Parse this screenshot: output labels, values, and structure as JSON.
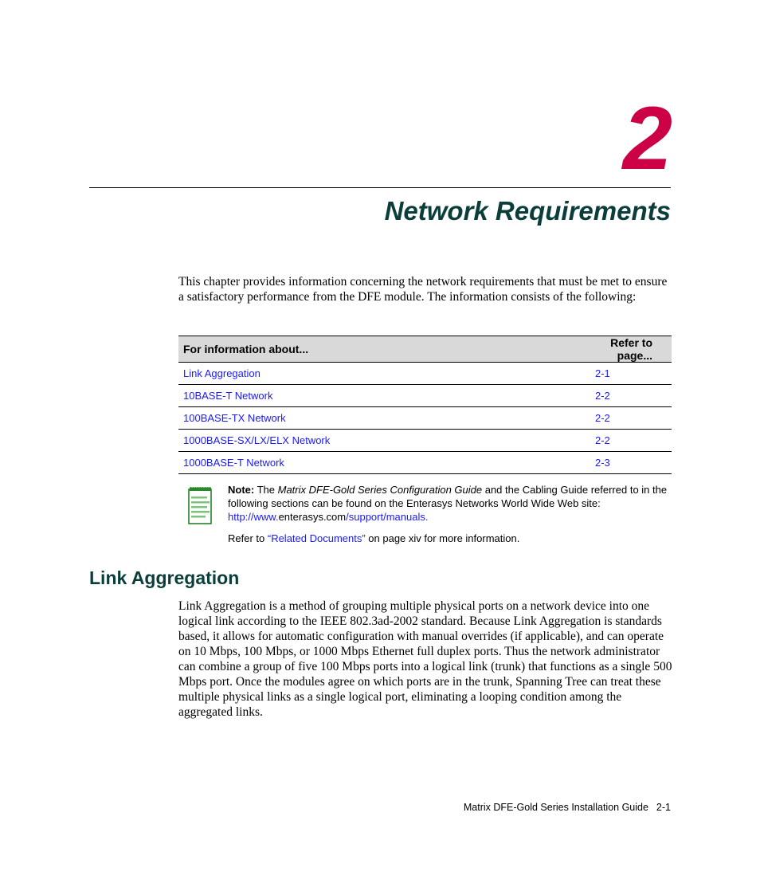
{
  "chapter": {
    "number": "2",
    "title": "Network Requirements",
    "number_color": "#cc0044",
    "title_color": "#0b3d3a"
  },
  "intro": "This chapter provides information concerning the network requirements that must be met to ensure a satisfactory performance from the DFE  module. The information consists of the following:",
  "toc": {
    "headers": [
      "For information about...",
      "Refer to page..."
    ],
    "rows": [
      {
        "topic": "Link Aggregation",
        "page": "2-1"
      },
      {
        "topic": "10BASE-T Network",
        "page": "2-2"
      },
      {
        "topic": "100BASE-TX Network",
        "page": "2-2"
      },
      {
        "topic": "1000BASE-SX/LX/ELX Network",
        "page": "2-2"
      },
      {
        "topic": "1000BASE-T Network",
        "page": "2-3"
      }
    ]
  },
  "note": {
    "icon": "notepad-icon",
    "label": "Note:",
    "text_before": " The ",
    "guide_title": "Matrix DFE-Gold Series Configuration Guide",
    "text_after": " and the Cabling Guide referred to in the following sections can be found on the Enterasys Networks World Wide Web site: ",
    "url_part1": "http://www.",
    "url_part2": "enterasys.com",
    "url_part3": "/support/manuals.",
    "refer_prefix": "Refer to  ",
    "refer_link": "“Related Documents”",
    "refer_suffix": " on page xiv for more information."
  },
  "section": {
    "heading": "Link Aggregation",
    "body": "Link Aggregation is a method of grouping multiple physical ports on a network device into one logical link according to the IEEE 802.3ad-2002 standard. Because Link Aggregation is standards based, it allows for automatic configuration with manual overrides (if applicable), and can operate on 10 Mbps, 100 Mbps, or 1000 Mbps Ethernet full duplex ports. Thus the network administrator can combine a group of five 100 Mbps ports into a logical link (trunk) that functions as a single 500 Mbps port. Once the modules agree on which ports are in the trunk, Spanning Tree can treat these multiple physical links as a single logical port, eliminating a looping condition among the aggregated links."
  },
  "footer": {
    "guide": "Matrix DFE-Gold Series Installation Guide",
    "page": "2-1"
  }
}
